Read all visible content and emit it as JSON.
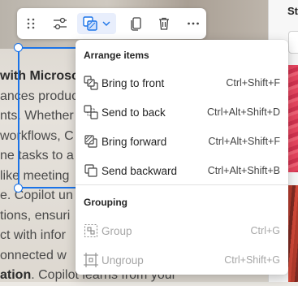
{
  "document": {
    "lines": [
      {
        "pre": "",
        "bold": "with Microso",
        "post": ""
      },
      {
        "pre": "ances produc",
        "bold": "",
        "post": ""
      },
      {
        "pre": "nts. Whether",
        "bold": "",
        "post": ""
      },
      {
        "pre": "workflows, C",
        "bold": "",
        "post": ""
      },
      {
        "pre": "ne tasks to a",
        "bold": "",
        "post": ""
      },
      {
        "pre": "like meeting",
        "bold": "",
        "post": ""
      },
      {
        "pre": "e. Copilot un",
        "bold": "",
        "post": ""
      },
      {
        "pre": "tions, ensuri",
        "bold": "",
        "post": ""
      },
      {
        "pre": "ct with infor",
        "bold": "",
        "post": ""
      },
      {
        "pre": "onnected w",
        "bold": "",
        "post": ""
      },
      {
        "pre": "",
        "bold": "ation",
        "post": ". Copilot learns from your"
      }
    ]
  },
  "right_panel": {
    "title": "St"
  },
  "toolbar": {
    "buttons": [
      {
        "name": "drag-handle-icon"
      },
      {
        "name": "adjust-settings-icon"
      },
      {
        "name": "arrange-icon"
      },
      {
        "name": "chevron-down-icon"
      },
      {
        "name": "copy-icon"
      },
      {
        "name": "delete-icon"
      },
      {
        "name": "more-options-icon"
      }
    ]
  },
  "menu": {
    "arrange_header": "Arrange items",
    "arrange_items": [
      {
        "label": "Bring to front",
        "shortcut": "Ctrl+Shift+F",
        "icon": "bring-to-front-icon"
      },
      {
        "label": "Send to back",
        "shortcut": "Ctrl+Alt+Shift+D",
        "icon": "send-to-back-icon"
      },
      {
        "label": "Bring forward",
        "shortcut": "Ctrl+Alt+Shift+F",
        "icon": "bring-forward-icon"
      },
      {
        "label": "Send backward",
        "shortcut": "Ctrl+Alt+Shift+B",
        "icon": "send-backward-icon"
      }
    ],
    "grouping_header": "Grouping",
    "grouping_items": [
      {
        "label": "Group",
        "shortcut": "Ctrl+G",
        "icon": "group-icon",
        "disabled": true
      },
      {
        "label": "Ungroup",
        "shortcut": "Ctrl+Shift+G",
        "icon": "ungroup-icon",
        "disabled": true
      }
    ]
  },
  "colors": {
    "accent": "#1a73e8",
    "active_button_bg": "#e8eefc",
    "disabled_text": "#a6a6a6"
  }
}
